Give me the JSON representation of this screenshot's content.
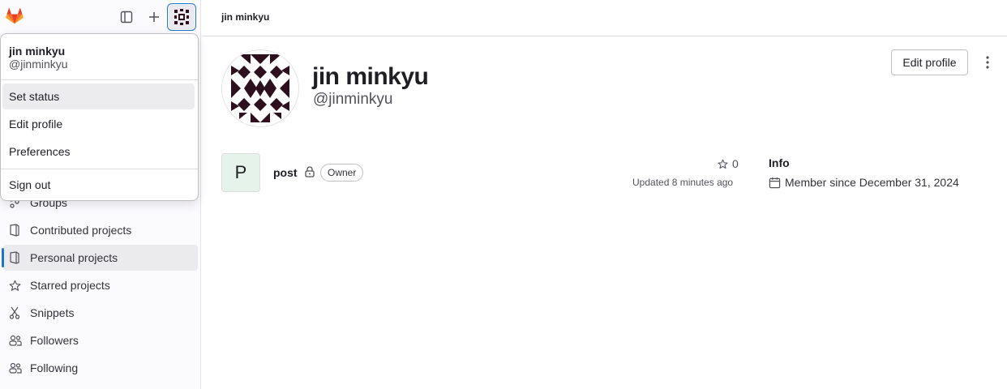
{
  "breadcrumb": "jin minkyu",
  "user_menu": {
    "name": "jin minkyu",
    "handle": "@jinminkyu",
    "items": [
      "Set status",
      "Edit profile",
      "Preferences"
    ],
    "sign_out": "Sign out"
  },
  "sidebar": {
    "items": [
      {
        "label": "Groups",
        "icon": "groups-icon"
      },
      {
        "label": "Contributed projects",
        "icon": "project-icon"
      },
      {
        "label": "Personal projects",
        "icon": "project-icon",
        "active": true
      },
      {
        "label": "Starred projects",
        "icon": "star-icon"
      },
      {
        "label": "Snippets",
        "icon": "snippet-icon"
      },
      {
        "label": "Followers",
        "icon": "users-icon"
      },
      {
        "label": "Following",
        "icon": "users-icon"
      }
    ]
  },
  "profile": {
    "name": "jin minkyu",
    "handle": "@jinminkyu",
    "edit_label": "Edit profile"
  },
  "project": {
    "initial": "P",
    "name": "post",
    "role": "Owner",
    "stars": "0",
    "updated": "Updated 8 minutes ago"
  },
  "info": {
    "heading": "Info",
    "member_since": "Member since December 31, 2024"
  },
  "colors": {
    "accent": "#1f75cb",
    "identicon": "#2d0f1e"
  }
}
